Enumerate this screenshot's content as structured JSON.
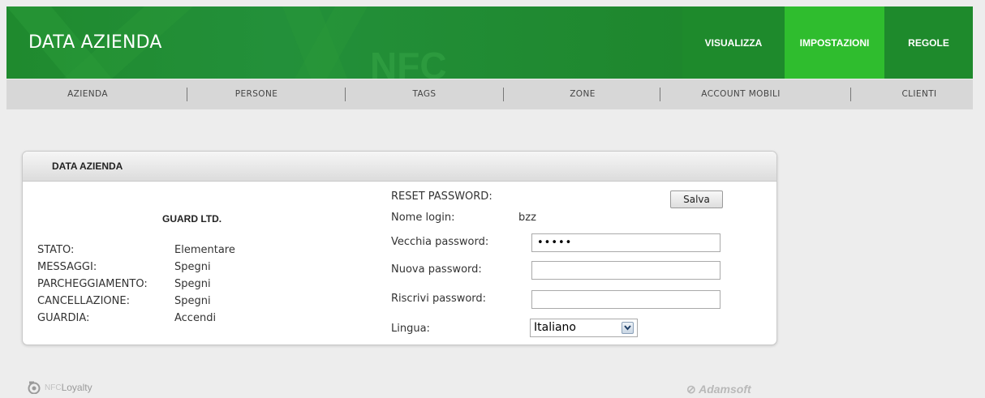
{
  "header": {
    "app_title": "DATA AZIENDA",
    "nav": [
      {
        "label": "VISUALIZZA",
        "active": false
      },
      {
        "label": "IMPOSTAZIONI",
        "active": true
      },
      {
        "label": "REGOLE",
        "active": false
      }
    ],
    "brand_color": "#1e8a2c",
    "active_color": "#2fbd2e"
  },
  "subnav": {
    "items": [
      "AZIENDA",
      "PERSONE",
      "TAGS",
      "ZONE",
      "ACCOUNT MOBILI",
      "CLIENTI"
    ]
  },
  "panel": {
    "title": "DATA AZIENDA",
    "company_name": "GUARD LTD.",
    "status": [
      {
        "key": "STATO:",
        "value": "Elementare"
      },
      {
        "key": "MESSAGGI:",
        "value": "Spegni"
      },
      {
        "key": "PARCHEGGIAMENTO:",
        "value": "Spegni"
      },
      {
        "key": "CANCELLAZIONE:",
        "value": "Spegni"
      },
      {
        "key": "GUARDIA:",
        "value": "Accendi"
      }
    ],
    "form": {
      "reset_label": "RESET PASSWORD:",
      "save_label": "Salva",
      "login_label": "Nome login:",
      "login_value": "bzz",
      "old_password_label": "Vecchia password:",
      "old_password_value": "•••••",
      "new_password_label": "Nuova password:",
      "new_password_value": "",
      "repeat_password_label": "Riscrivi password:",
      "repeat_password_value": "",
      "language_label": "Lingua:",
      "language_value": "Italiano"
    }
  },
  "footer": {
    "left_logo_prefix": "NFC",
    "left_logo_text": "Loyalty",
    "right_logo": "Adamsoft"
  }
}
